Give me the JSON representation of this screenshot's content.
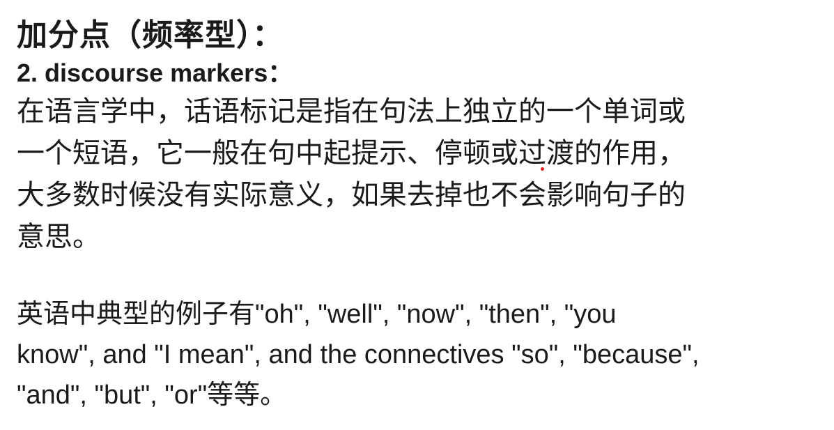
{
  "slide": {
    "heading": "加分点（频率型）：",
    "subheading": "2. discourse markers：",
    "definition_lines": [
      "在语言学中，话语标记是指在句法上独立的一个单词或",
      "一个短语，它一般在句中起提示、停顿或过渡的作用，",
      "大多数时候没有实际意义，如果去掉也不会影响句子的",
      "意思。"
    ],
    "example_lines": [
      "英语中典型的例子有\"oh\", \"well\", \"now\", \"then\", \"you",
      "know\", and \"I mean\", and the connectives \"so\", \"because\",",
      "\"and\", \"but\", \"or\"等等。"
    ]
  },
  "colors": {
    "text": "#1a1a1a",
    "background": "#ffffff",
    "pointer_dot": "#e02020"
  }
}
